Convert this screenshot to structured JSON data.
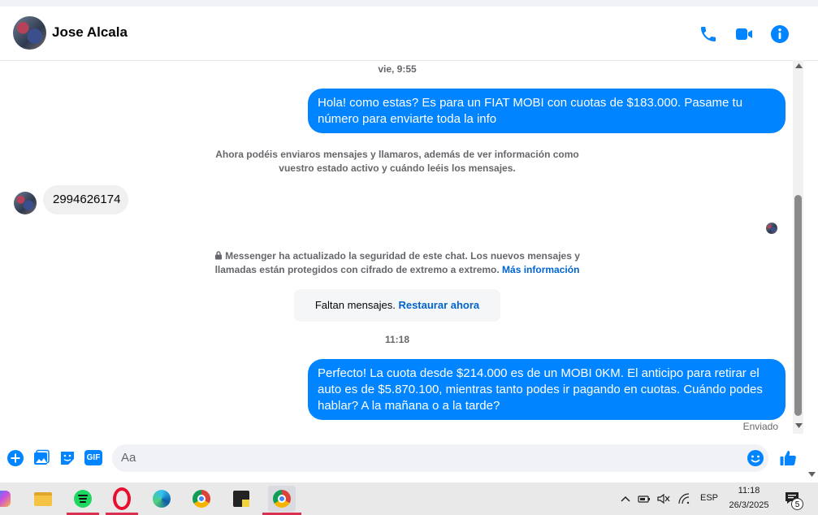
{
  "header": {
    "contact_name": "Jose Alcala"
  },
  "messages": {
    "timestamp_1": "vie, 9:55",
    "out_1": "Hola! como estas? Es para un FIAT MOBI con cuotas de $183.000. Pasame tu número para enviarte toda la info",
    "notice_1_line1": "Ahora podéis enviaros mensajes y llamaros, además de ver información como",
    "notice_1_line2": "vuestro estado activo y cuándo leéis los mensajes.",
    "in_1": "2994626174",
    "security_line1": "Messenger ha actualizado la seguridad de este chat. Los nuevos mensajes y",
    "security_line2": "llamadas están protegidos con cifrado de extremo a extremo.",
    "security_link": "Más información",
    "missing_text": "Faltan mensajes.",
    "missing_link": "Restaurar ahora",
    "timestamp_2": "11:18",
    "out_2": "Perfecto! La cuota desde $214.000 es de un MOBI 0KM. El anticipo para retirar el auto es de $5.870.100, mientras tanto podes ir pagando en cuotas. Cuándo podes hablar? A la mañana o a la tarde?",
    "status": "Enviado"
  },
  "composer": {
    "placeholder": "Aa",
    "gif_label": "GIF"
  },
  "taskbar": {
    "apps": [
      "copilot-icon",
      "file-explorer-icon",
      "spotify-icon",
      "opera-icon",
      "edge-icon",
      "chrome-icon",
      "sticky-notes-icon",
      "chrome-profile-icon"
    ],
    "language": "ESP",
    "time": "11:18",
    "date": "26/3/2025",
    "notification_count": "5"
  },
  "colors": {
    "accent": "#0084ff",
    "link": "#0064d1",
    "bubble_in": "#f0f0f0"
  }
}
